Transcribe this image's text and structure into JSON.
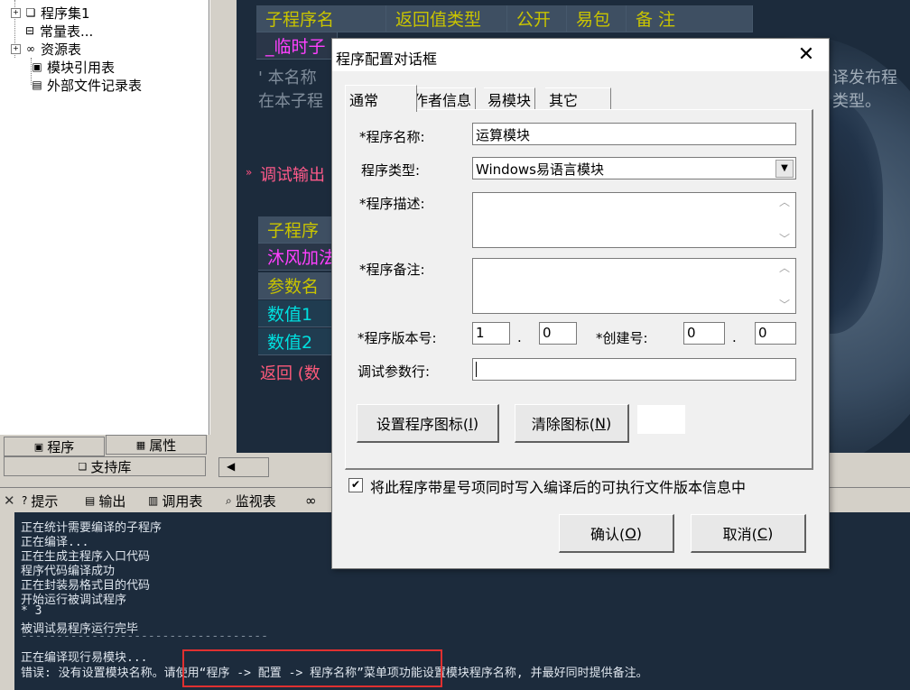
{
  "tree": {
    "items": [
      {
        "label": "程序集1",
        "icon": "assembly-icon"
      },
      {
        "label": "常量表...",
        "icon": "constant-icon"
      },
      {
        "label": "资源表",
        "icon": "resource-icon"
      },
      {
        "label": "模块引用表",
        "icon": "module-ref-icon"
      },
      {
        "label": "外部文件记录表",
        "icon": "file-record-icon"
      }
    ],
    "tab_program": "程序",
    "tab_property": "属性",
    "tab_support": "支持库"
  },
  "editor": {
    "sub_header": [
      "子程序名",
      "返回值类型",
      "公开",
      "易包",
      "备 注"
    ],
    "sub_name": "_临时子",
    "comment1": "' 本名称",
    "comment1_right": "译发布程",
    "comment2": "在本子程",
    "comment2_right": "类型。",
    "debug_out": "调试输出",
    "sub2_header": "子程序",
    "sub2_name": "沐风加法",
    "param_header": "参数名",
    "param1": "数值1",
    "param2": "数值2",
    "return_line": "返回 (数"
  },
  "bottom_tabs": [
    {
      "label": "提示",
      "icon": "hint-icon"
    },
    {
      "label": "输出",
      "icon": "output-icon"
    },
    {
      "label": "调用表",
      "icon": "call-table-icon"
    },
    {
      "label": "监视表",
      "icon": "watch-icon"
    }
  ],
  "output": {
    "lines": [
      "正在统计需要编译的子程序",
      "正在编译...",
      "正在生成主程序入口代码",
      "程序代码编译成功",
      "正在封装易格式目的代码",
      "开始运行被调试程序",
      "* 3",
      "被调试易程序运行完毕",
      "-----------------------------------",
      "正在编译现行易模块..."
    ],
    "error_line": "错误: 没有设置模块名称。请使用“程序 -> 配置 -> 程序名称”菜单项功能设置模块程序名称, 并最好同时提供备注。"
  },
  "dialog": {
    "title": "程序配置对话框",
    "tabs": [
      "通常",
      "作者信息",
      "易模块",
      "其它"
    ],
    "name_label": "*程序名称:",
    "name_value": "运算模块",
    "type_label": "程序类型:",
    "type_value": "Windows易语言模块",
    "desc_label": "*程序描述:",
    "desc_value": "",
    "note_label": "*程序备注:",
    "note_value": "",
    "version_label": "*程序版本号:",
    "version_major": "1",
    "version_minor": "0",
    "build_label": "*创建号:",
    "build_major": "0",
    "build_minor": "0",
    "dot": ".",
    "debug_params_label": "调试参数行:",
    "debug_params_value": "",
    "set_icon_button": "设置程序图标(",
    "set_icon_key": "I",
    "clear_icon_button": "清除图标(",
    "clear_icon_key": "N",
    "paren_close": ")",
    "checkbox_label": "将此程序带星号项同时写入编译后的可执行文件版本信息中",
    "checkbox_checked": "✔",
    "ok_button": "确认(",
    "ok_key": "O",
    "cancel_button": "取消(",
    "cancel_key": "C",
    "close_glyph": "✕"
  }
}
